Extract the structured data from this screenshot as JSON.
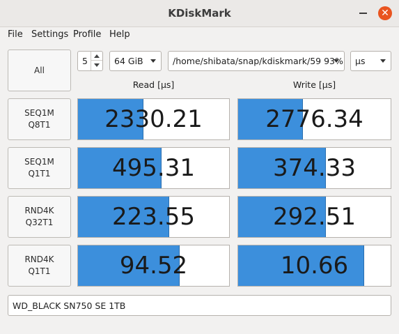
{
  "window": {
    "title": "KDiskMark"
  },
  "menu": [
    "File",
    "Settings",
    "Profile",
    "Help"
  ],
  "controls": {
    "all_button": "All",
    "loops": "5",
    "size": "64 GiB",
    "path": "/home/shibata/snap/kdiskmark/59 93% (",
    "unit": "µs"
  },
  "headers": {
    "read": "Read [µs]",
    "write": "Write [µs]"
  },
  "tests": [
    {
      "line1": "SEQ1M",
      "line2": "Q8T1",
      "read": "2330.21",
      "write": "2776.34",
      "read_fill": 0.43,
      "write_fill": 0.42
    },
    {
      "line1": "SEQ1M",
      "line2": "Q1T1",
      "read": "495.31",
      "write": "374.33",
      "read_fill": 0.55,
      "write_fill": 0.57
    },
    {
      "line1": "RND4K",
      "line2": "Q32T1",
      "read": "223.55",
      "write": "292.51",
      "read_fill": 0.6,
      "write_fill": 0.57
    },
    {
      "line1": "RND4K",
      "line2": "Q1T1",
      "read": "94.52",
      "write": "10.66",
      "read_fill": 0.67,
      "write_fill": 0.82
    }
  ],
  "device": "WD_BLACK SN750 SE 1TB",
  "colors": {
    "bar": "#3c8fdc",
    "close": "#e9541f"
  }
}
